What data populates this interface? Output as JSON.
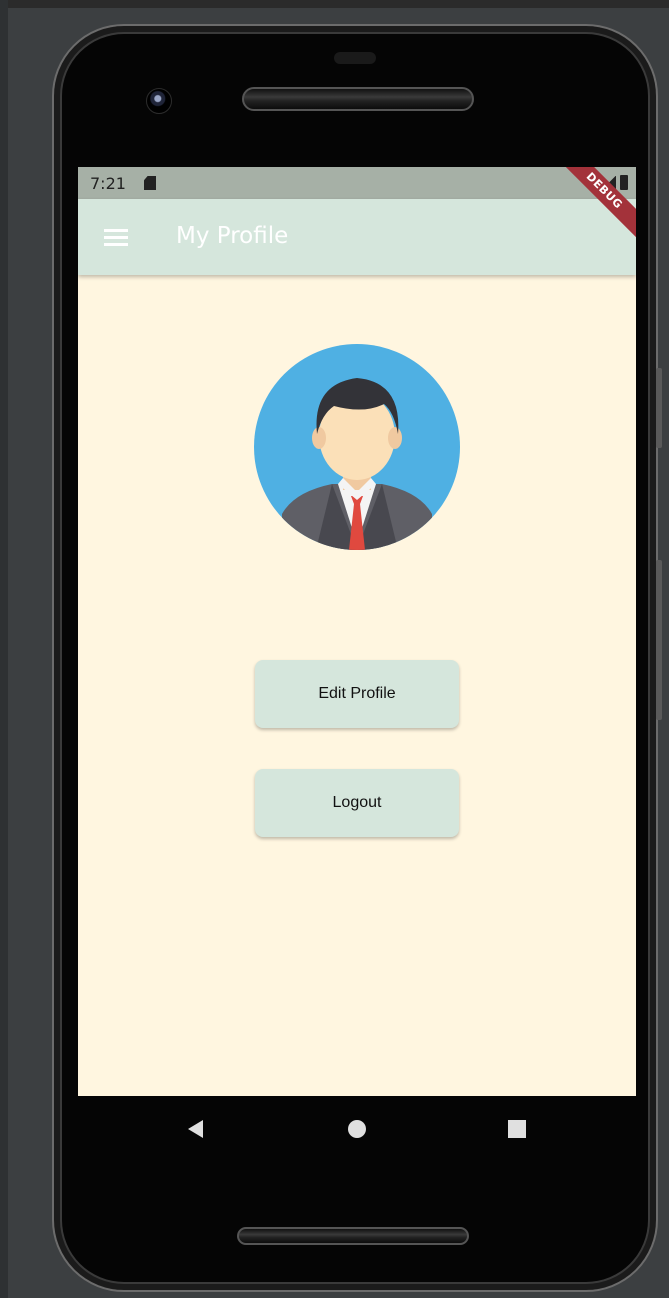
{
  "status_bar": {
    "time": "7:21"
  },
  "app_bar": {
    "title": "My Profile",
    "menu_icon": "hamburger-menu-icon"
  },
  "debug_banner": "DEBUG",
  "avatar": {
    "icon": "user-avatar-icon"
  },
  "buttons": {
    "edit_profile": "Edit Profile",
    "logout": "Logout"
  },
  "nav": {
    "back_icon": "back-triangle-icon",
    "home_icon": "home-circle-icon",
    "recents_icon": "recents-square-icon"
  },
  "colors": {
    "app_bar": "#d5e6dc",
    "screen_background": "#fff6e0",
    "button_background": "#d5e6dc",
    "avatar_background": "#4fb0e3",
    "status_bar": "#a6b0a6"
  }
}
